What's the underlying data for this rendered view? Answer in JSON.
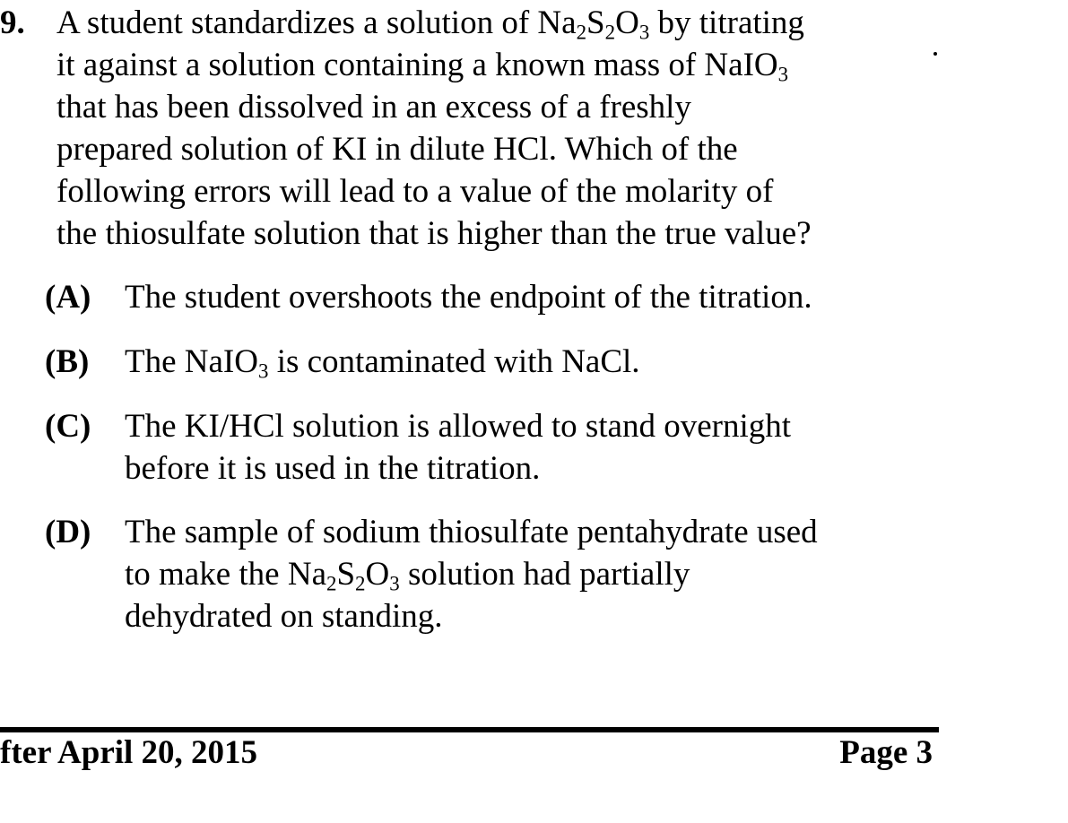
{
  "question": {
    "number": "9.",
    "stem": [
      [
        "A student standardizes a solution of Na",
        "2",
        "S",
        "2",
        "O",
        "3",
        " by titrating"
      ],
      [
        "it against a solution containing a known mass of NaIO",
        "3"
      ],
      [
        "that has been dissolved in an excess of a freshly"
      ],
      [
        "prepared solution of KI in dilute HCl.  Which of the"
      ],
      [
        "following errors will lead to a value of the molarity of"
      ],
      [
        "the thiosulfate solution that is higher than the true value?"
      ]
    ],
    "choices": [
      {
        "letter": "(A)",
        "lines": [
          [
            "The student overshoots the endpoint of the titration."
          ]
        ]
      },
      {
        "letter": "(B)",
        "lines": [
          [
            "The NaIO",
            "3",
            " is contaminated with NaCl."
          ]
        ]
      },
      {
        "letter": "(C)",
        "lines": [
          [
            "The KI/HCl solution is allowed to stand overnight"
          ],
          [
            "before it is used in the titration."
          ]
        ]
      },
      {
        "letter": "(D)",
        "lines": [
          [
            "The sample of sodium thiosulfate pentahydrate used"
          ],
          [
            "to make the Na",
            "2",
            "S",
            "2",
            "O",
            "3",
            " solution had partially"
          ],
          [
            "dehydrated on standing."
          ]
        ]
      }
    ]
  },
  "footer": {
    "left_text": "fter April 20, 2015",
    "right_text": "Page  3"
  }
}
